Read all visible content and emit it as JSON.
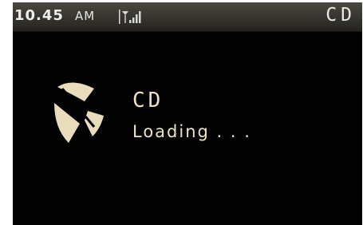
{
  "status_bar": {
    "time": "10.45",
    "ampm": "AM",
    "signal_icon": "signal-strength-icon",
    "app_title": "CD"
  },
  "main": {
    "logo_icon": "cd-app-logo-icon",
    "app_name": "CD",
    "loading_text": "Loading . . ."
  },
  "colors": {
    "background": "#020202",
    "status_bar": "#3a3832",
    "accent_text": "#ece2c6"
  }
}
